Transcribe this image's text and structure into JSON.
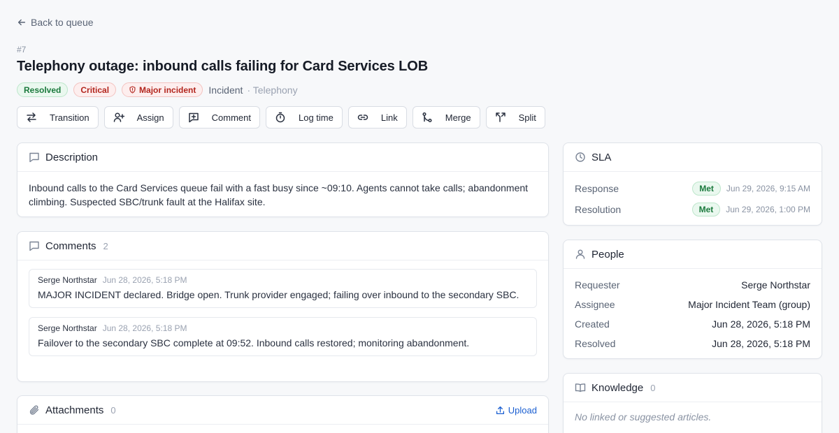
{
  "nav": {
    "back_label": "Back to queue"
  },
  "ticket": {
    "id": "#7",
    "title": "Telephony outage: inbound calls failing for Card Services LOB",
    "status": "Resolved",
    "priority": "Critical",
    "flag": "Major incident",
    "type": "Incident",
    "category": "· Telephony"
  },
  "toolbar": {
    "transition": "Transition",
    "assign": "Assign",
    "comment": "Comment",
    "log_time": "Log time",
    "link": "Link",
    "merge": "Merge",
    "split": "Split"
  },
  "description": {
    "title": "Description",
    "text": "Inbound calls to the Card Services queue fail with a fast busy since ~09:10. Agents cannot take calls; abandonment climbing. Suspected SBC/trunk fault at the Halifax site."
  },
  "comments": {
    "title": "Comments",
    "count": "2",
    "items": [
      {
        "author": "Serge Northstar",
        "time": "Jun 28, 2026, 5:18 PM",
        "text": "MAJOR INCIDENT declared. Bridge open. Trunk provider engaged; failing over inbound to the secondary SBC."
      },
      {
        "author": "Serge Northstar",
        "time": "Jun 28, 2026, 5:18 PM",
        "text": "Failover to the secondary SBC complete at 09:52. Inbound calls restored; monitoring abandonment."
      }
    ]
  },
  "attachments": {
    "title": "Attachments",
    "count": "0",
    "upload_label": "Upload"
  },
  "sla": {
    "title": "SLA",
    "rows": [
      {
        "label": "Response",
        "badge": "Met",
        "date": "Jun 29, 2026, 9:15 AM"
      },
      {
        "label": "Resolution",
        "badge": "Met",
        "date": "Jun 29, 2026, 1:00 PM"
      }
    ]
  },
  "people": {
    "title": "People",
    "rows": [
      {
        "label": "Requester",
        "value": "Serge Northstar"
      },
      {
        "label": "Assignee",
        "value": "Major Incident Team (group)"
      },
      {
        "label": "Created",
        "value": "Jun 28, 2026, 5:18 PM"
      },
      {
        "label": "Resolved",
        "value": "Jun 28, 2026, 5:18 PM"
      }
    ]
  },
  "knowledge": {
    "title": "Knowledge",
    "count": "0",
    "empty_text": "No linked or suggested articles."
  },
  "colors": {
    "accent": "#1b5fd1",
    "success": "#1b7a3d",
    "danger": "#b3261e"
  }
}
